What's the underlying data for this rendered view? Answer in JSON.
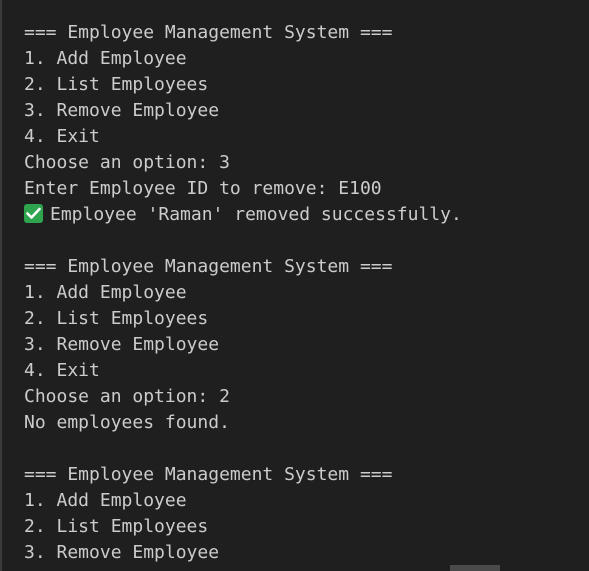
{
  "terminal": {
    "lines": [
      "=== Employee Management System ===",
      "1. Add Employee",
      "2. List Employees",
      "3. Remove Employee",
      "4. Exit",
      "Choose an option: 3",
      "Enter Employee ID to remove: E100",
      "Employee 'Raman' removed successfully.",
      "",
      "=== Employee Management System ===",
      "1. Add Employee",
      "2. List Employees",
      "3. Remove Employee",
      "4. Exit",
      "Choose an option: 2",
      "No employees found.",
      "",
      "=== Employee Management System ===",
      "1. Add Employee",
      "2. List Employees",
      "3. Remove Employee"
    ],
    "success_icon": "check-mark-button-icon",
    "colors": {
      "background": "#1f1f1f",
      "text": "#cccccc",
      "success": "#2ea44f"
    }
  }
}
